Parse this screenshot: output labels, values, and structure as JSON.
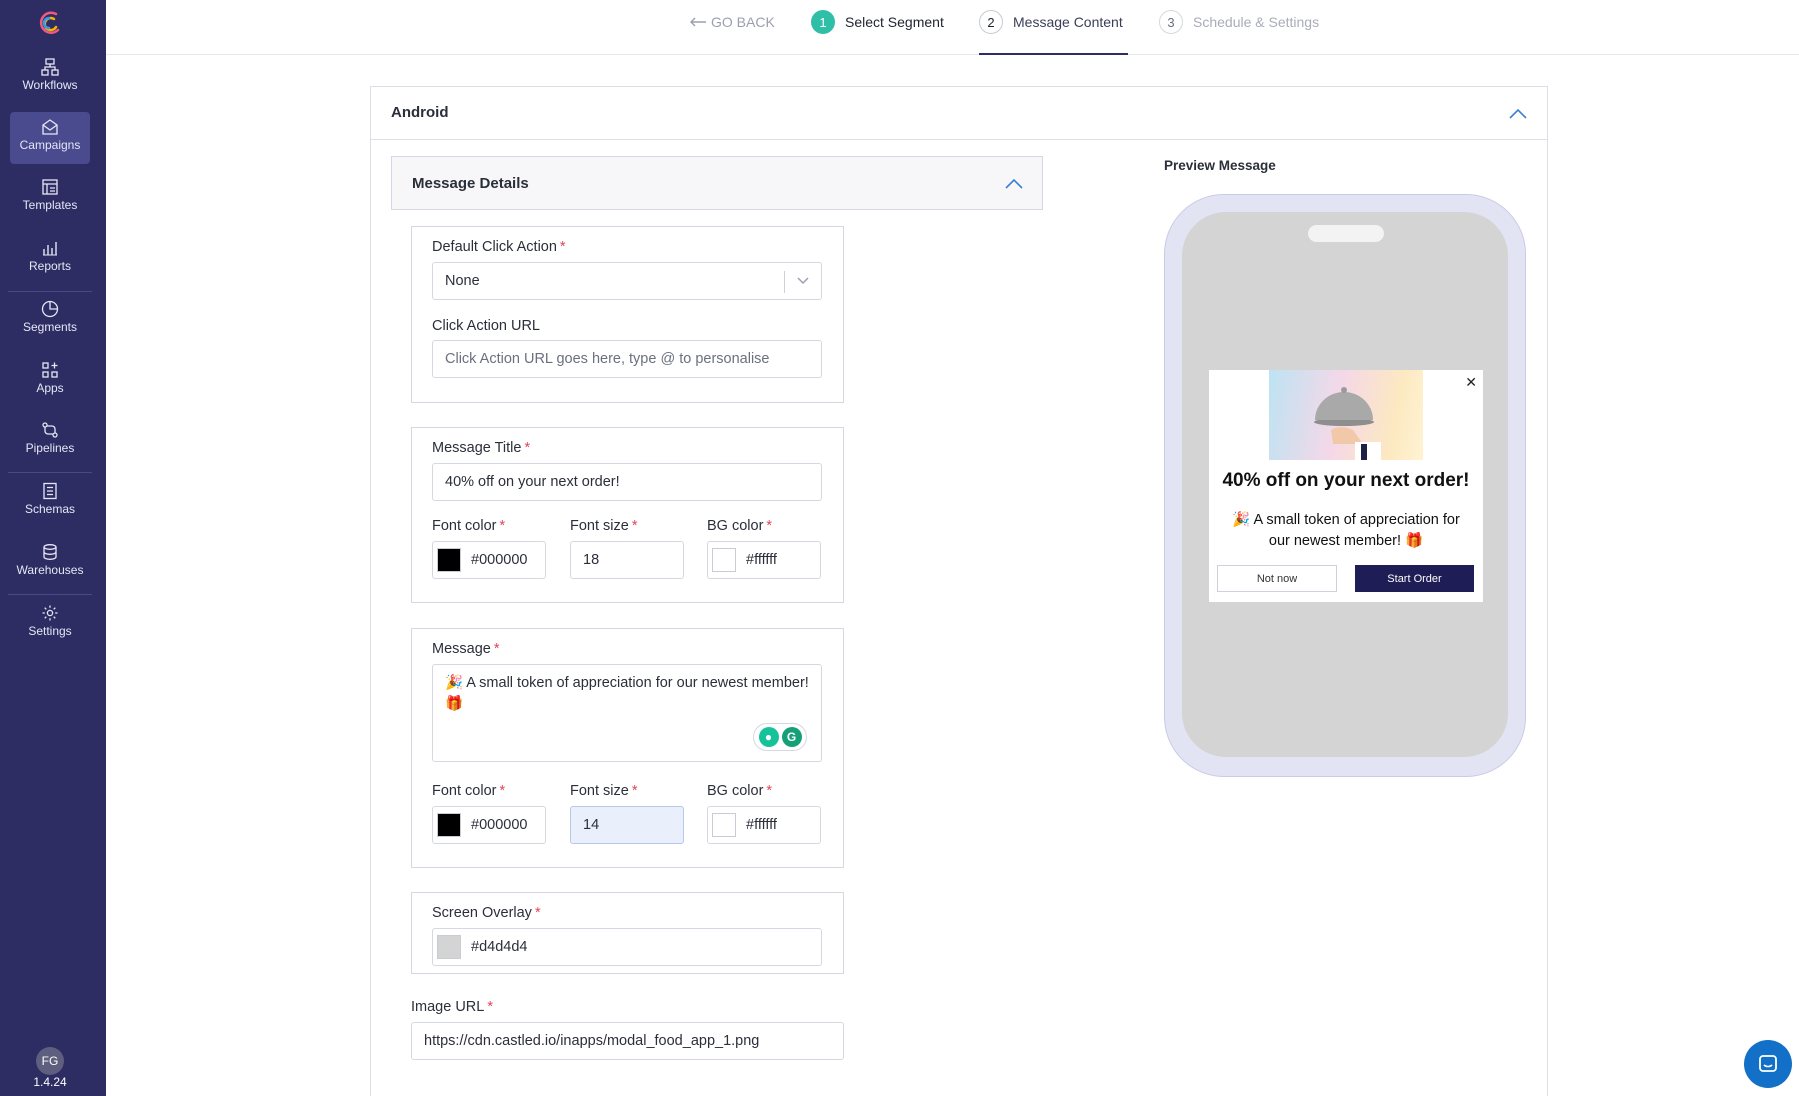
{
  "app": {
    "version": "1.4.24",
    "avatar_initials": "FG",
    "accent": "#2e2d63"
  },
  "sidebar": {
    "items": [
      {
        "label": "Workflows",
        "icon": "workflow-icon"
      },
      {
        "label": "Campaigns",
        "icon": "campaign-icon",
        "active": true
      },
      {
        "label": "Templates",
        "icon": "template-icon"
      },
      {
        "label": "Reports",
        "icon": "reports-icon"
      },
      {
        "label": "Segments",
        "icon": "segments-icon"
      },
      {
        "label": "Apps",
        "icon": "apps-icon"
      },
      {
        "label": "Pipelines",
        "icon": "pipelines-icon"
      },
      {
        "label": "Schemas",
        "icon": "schemas-icon"
      },
      {
        "label": "Warehouses",
        "icon": "warehouses-icon"
      },
      {
        "label": "Settings",
        "icon": "gear-icon"
      }
    ]
  },
  "stepper": {
    "go_back": "GO BACK",
    "steps": [
      {
        "num": "1",
        "label": "Select Segment",
        "state": "done"
      },
      {
        "num": "2",
        "label": "Message Content",
        "state": "active"
      },
      {
        "num": "3",
        "label": "Schedule & Settings",
        "state": "pending"
      }
    ]
  },
  "platform": {
    "title": "Android"
  },
  "details": {
    "title": "Message Details",
    "default_click_action": {
      "label": "Default Click Action",
      "value": "None"
    },
    "click_action_url": {
      "label": "Click Action URL",
      "placeholder": "Click Action URL goes here, type @ to personalise"
    },
    "message_title": {
      "label": "Message Title",
      "value": "40% off on your next order!",
      "font_color_label": "Font color",
      "font_color": "#000000",
      "font_size_label": "Font size",
      "font_size": "18",
      "bg_color_label": "BG color",
      "bg_color": "#ffffff"
    },
    "message": {
      "label": "Message",
      "value": "🎉 A small token of appreciation for our newest member! 🎁",
      "font_color_label": "Font color",
      "font_color": "#000000",
      "font_size_label": "Font size",
      "font_size": "14",
      "bg_color_label": "BG color",
      "bg_color": "#ffffff"
    },
    "screen_overlay": {
      "label": "Screen Overlay",
      "value": "#d4d4d4"
    },
    "image_url": {
      "label": "Image URL",
      "value": "https://cdn.castled.io/inapps/modal_food_app_1.png"
    }
  },
  "preview": {
    "label": "Preview Message",
    "title": "40% off on your next order!",
    "message": "🎉 A small token of appreciation for our newest member! 🎁",
    "secondary_button": "Not now",
    "primary_button": "Start Order",
    "close_glyph": "✕"
  }
}
